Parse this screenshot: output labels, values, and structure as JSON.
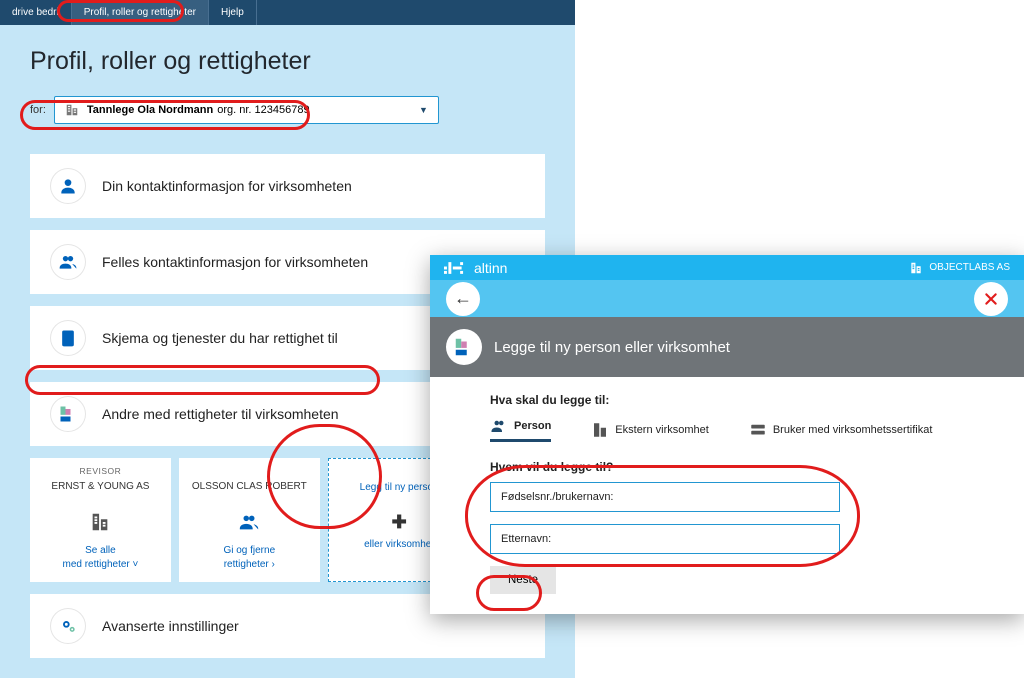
{
  "nav": {
    "items": [
      "drive bedri",
      "Profil, roller og rettigheter",
      "Hjelp"
    ],
    "active_index": 1
  },
  "page_title": "Profil, roller og rettigheter",
  "for_label": "for:",
  "actor": {
    "name": "Tannlege Ola Nordmann",
    "org_label": "org. nr.",
    "org_nr": "123456789"
  },
  "rows": [
    "Din kontaktinformasjon for virksomheten",
    "Felles kontaktinformasjon for virksomheten",
    "Skjema og tjenester du har rettighet til",
    "Andre med rettigheter til virksomheten",
    "Avanserte innstillinger"
  ],
  "rights_panel": {
    "revisor_label": "REVISOR",
    "revisor_name": "ERNST & YOUNG AS",
    "revisor_link1": "Se alle",
    "revisor_link2": "med rettigheter ˅",
    "person_name": "OLSSON CLAS ROBERT",
    "person_link1": "Gi og fjerne",
    "person_link2": "rettigheter ›",
    "add_line1": "Legg til ny person",
    "add_line2": "eller virksomhet"
  },
  "overlay": {
    "brand": "altinn",
    "org_name": "OBJECTLABS AS",
    "heading": "Legge til ny person eller virksomhet",
    "prompt": "Hva skal du legge til:",
    "tabs": {
      "person": "Person",
      "company": "Ekstern virksomhet",
      "cert": "Bruker med virksomhetssertifikat"
    },
    "who_prompt": "Hvem vil du legge til?",
    "ssn_placeholder": "Fødselsnr./brukernavn:",
    "surname_placeholder": "Etternavn:",
    "next_label": "Neste"
  }
}
